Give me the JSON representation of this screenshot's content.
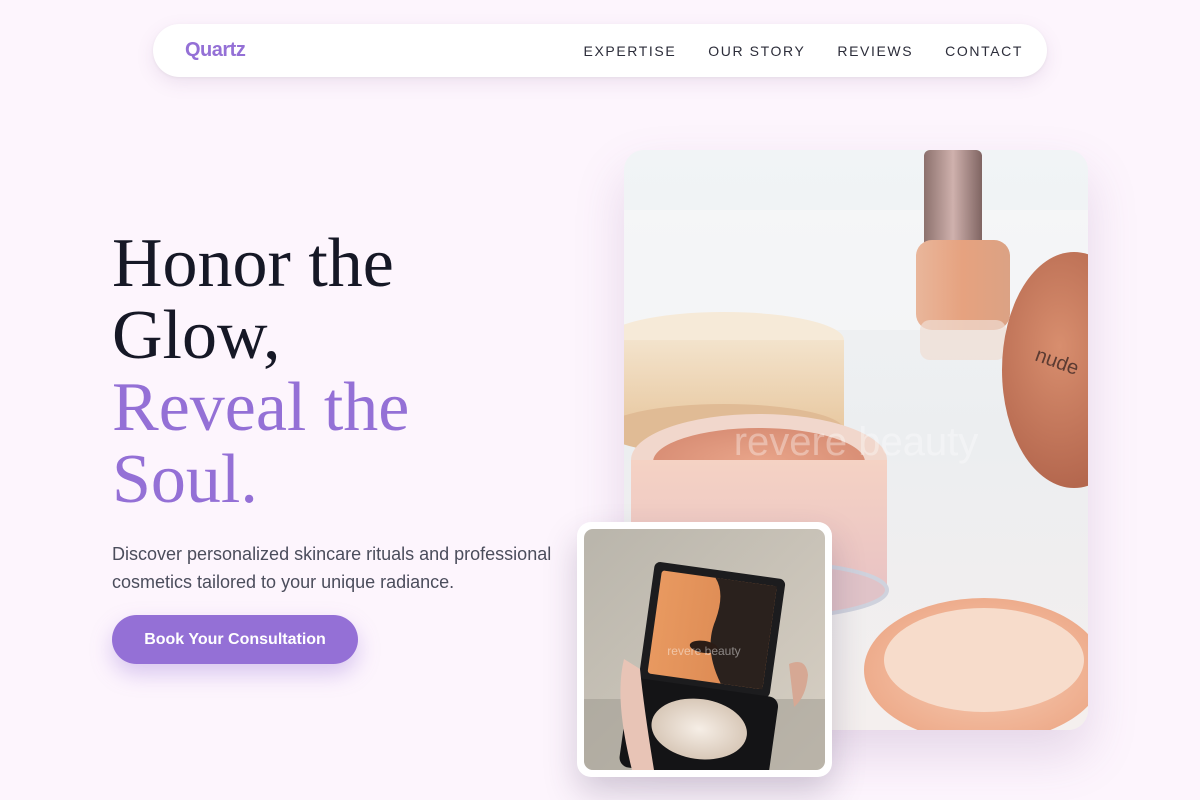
{
  "brand": {
    "name": "Quartz",
    "color": "#9470d6"
  },
  "nav": {
    "links": [
      {
        "label": "EXPERTISE"
      },
      {
        "label": "OUR STORY"
      },
      {
        "label": "REVIEWS"
      },
      {
        "label": "CONTACT"
      }
    ]
  },
  "hero": {
    "title_line_1": "Honor the",
    "title_line_2": "Glow,",
    "title_accent_line_1": "Reveal the",
    "title_accent_line_2": "Soul.",
    "description": "Discover personalized skincare rituals and professional cosmetics tailored to your unique radiance.",
    "cta_label": "Book Your Consultation"
  },
  "images": {
    "main_watermark": "revere beauty",
    "main_jar_label": "nude",
    "small_watermark": "revere beauty"
  },
  "colors": {
    "background": "#fdf5fd",
    "accent": "#9470d6",
    "heading": "#161826",
    "body_text": "#4b4d5c"
  }
}
